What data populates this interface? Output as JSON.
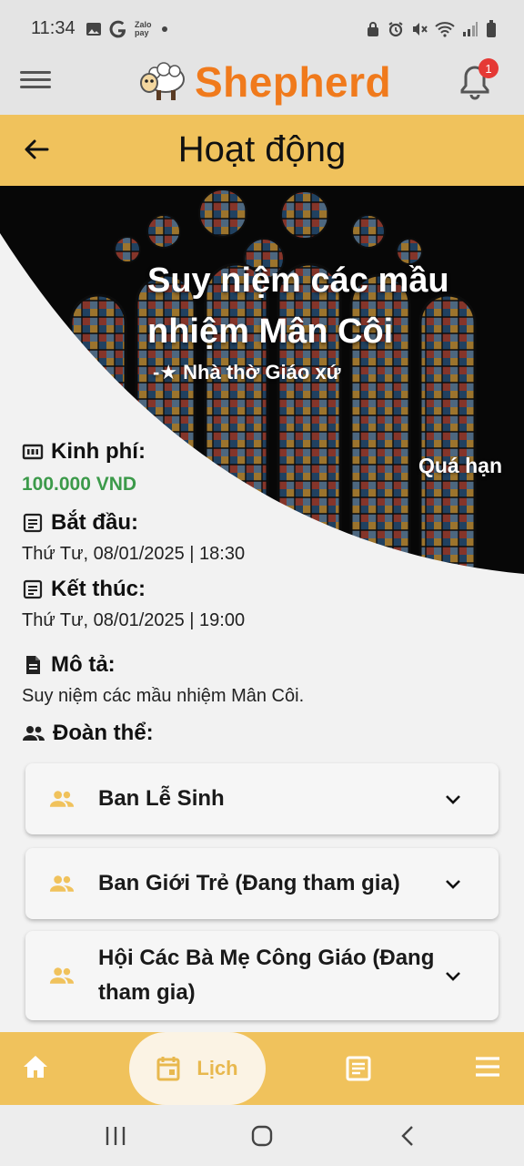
{
  "status_bar": {
    "time": "11:34",
    "left_icons": [
      "gallery-icon",
      "google-icon",
      "zalopay-icon",
      "dot-icon"
    ],
    "zalopay_text": "Zalo pay",
    "right_icons": [
      "lock-icon",
      "alarm-icon",
      "mute-icon",
      "wifi-icon",
      "signal-icon",
      "battery-icon"
    ]
  },
  "app_bar": {
    "logo_text": "Shepherd",
    "notification_count": "1"
  },
  "title_bar": {
    "title": "Hoạt động"
  },
  "event": {
    "title": "Suy niệm các mầu nhiệm Mân Côi",
    "place": "-★ Nhà thờ Giáo xứ",
    "status": "Quá hạn"
  },
  "details": {
    "cost_label": "Kinh phí:",
    "cost_value": "100.000 VND",
    "start_label": "Bắt đầu:",
    "start_value": "Thứ Tư, 08/01/2025 | 18:30",
    "end_label": "Kết thúc:",
    "end_value": "Thứ Tư, 08/01/2025 | 19:00",
    "desc_label": "Mô tả:",
    "desc_value": "Suy niệm các mầu nhiệm Mân Côi.",
    "groups_label": "Đoàn thể:"
  },
  "groups": [
    {
      "label": "Ban Lễ Sinh"
    },
    {
      "label": "Ban Giới Trẻ (Đang tham gia)"
    },
    {
      "label": "Hội Các Bà Mẹ Công Giáo (Đang tham gia)"
    }
  ],
  "bottom_nav": {
    "calendar_label": "Lịch"
  },
  "colors": {
    "accent": "#f0c25c",
    "brand_orange": "#f07a1c",
    "cost_green": "#3c9a4a",
    "badge_red": "#e53935"
  }
}
